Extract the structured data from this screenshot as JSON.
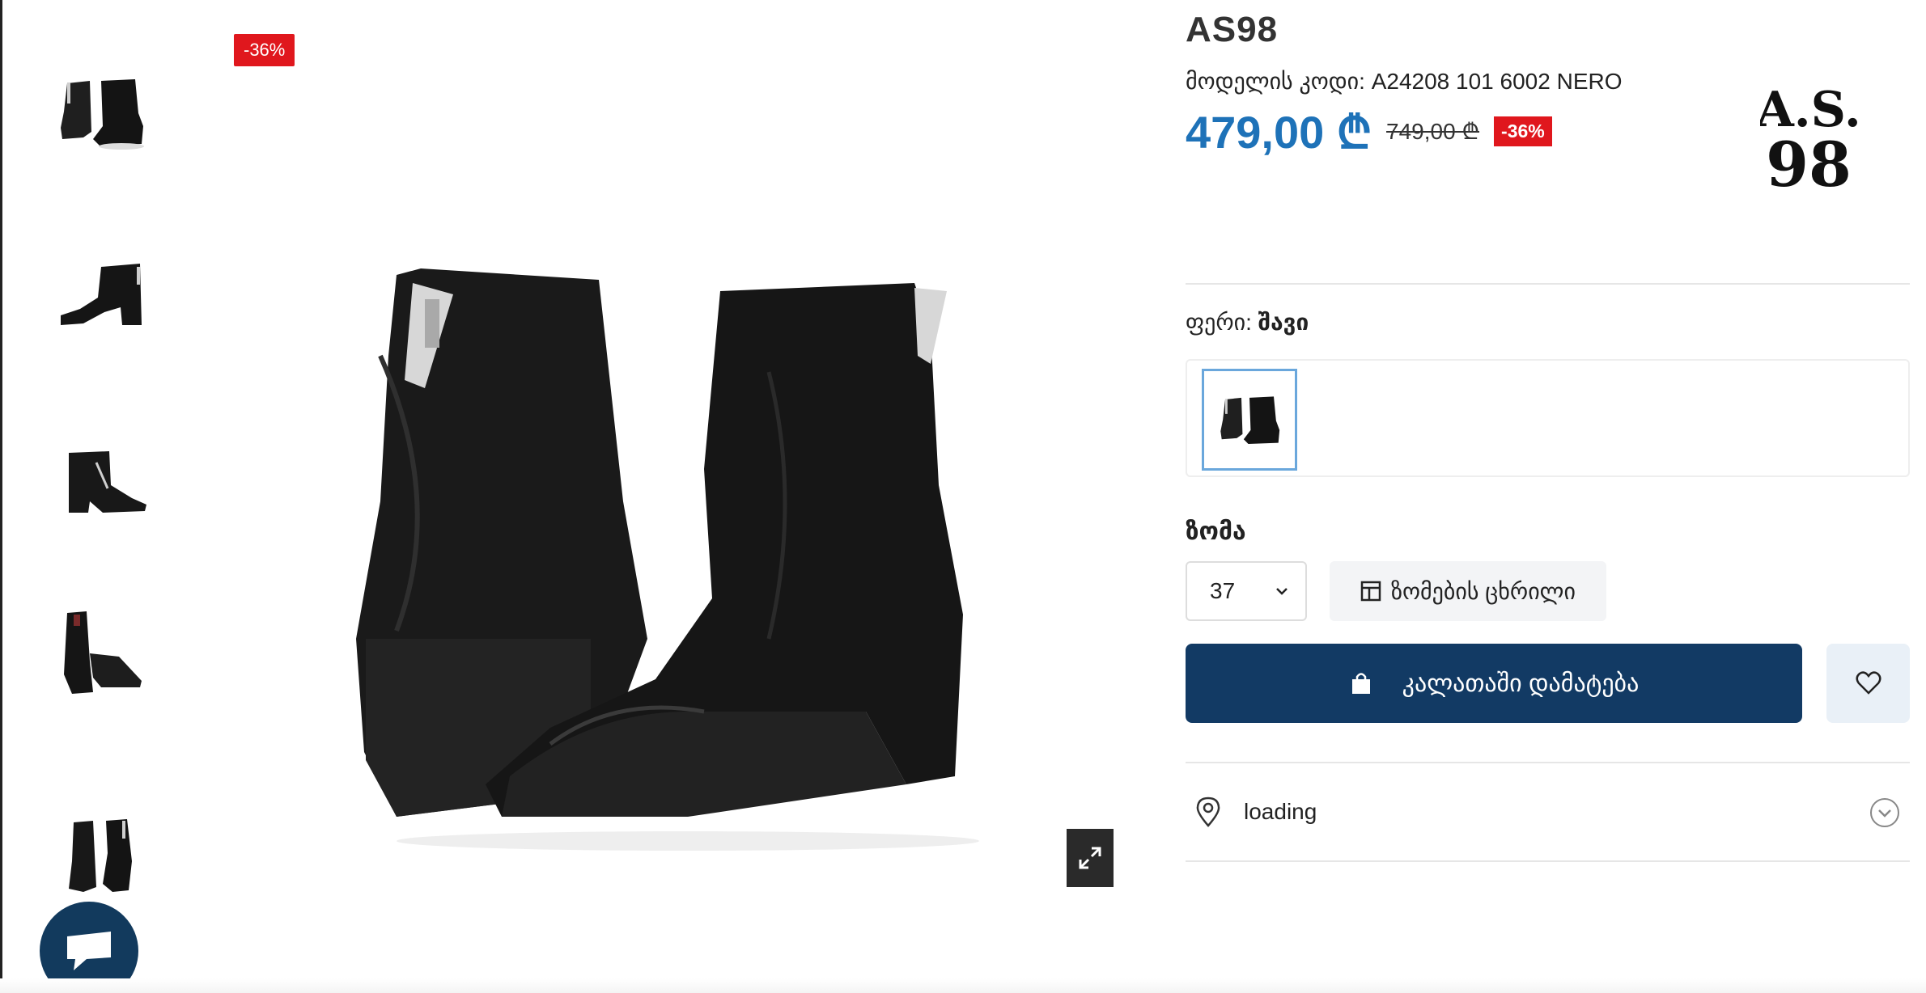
{
  "product": {
    "brand": "AS98",
    "model_code": "მოდელის კოდი: A24208 101 6002 NERO",
    "price_current": "479,00 ₾",
    "price_old": "749,00 ₾",
    "discount": "-36%",
    "image_discount": "-36%",
    "brand_logo_text": "A.S. 98"
  },
  "color": {
    "label": "ფერი:",
    "value": "შავი"
  },
  "size": {
    "label": "ზომა",
    "selected": "37",
    "size_table_label": "ზომების ცხრილი"
  },
  "cart": {
    "add_label": "კალათაში დამატება"
  },
  "delivery": {
    "location_text": "loading"
  },
  "icons": {
    "zoom": "expand-icon",
    "chat": "chat-icon",
    "bag": "shopping-bag-icon",
    "heart": "heart-icon",
    "pin": "location-pin-icon",
    "chevron": "chevron-down-icon",
    "table": "size-table-icon"
  },
  "colors": {
    "price": "#1e72b8",
    "discount": "#e0171d",
    "primary_button": "#123a64",
    "chat": "#123a5d"
  }
}
